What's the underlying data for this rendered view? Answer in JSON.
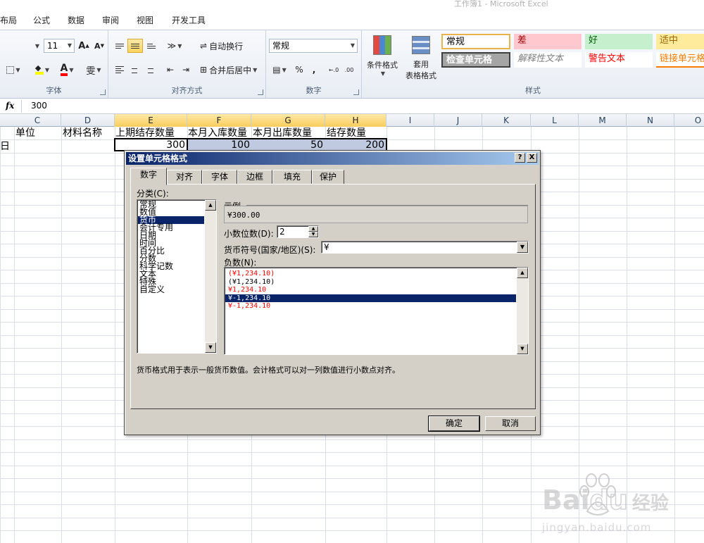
{
  "window": {
    "title": "工作簿1 - Microsoft Excel"
  },
  "ribbon_tabs": [
    "布局",
    "公式",
    "数据",
    "审阅",
    "视图",
    "开发工具"
  ],
  "font_group": {
    "label": "字体",
    "size": "11",
    "grow_icon": "A",
    "shrink_icon": "A",
    "font_color_icon": "A",
    "phonetic_icon": "雯"
  },
  "align_group": {
    "label": "对齐方式",
    "wrap_text": "自动换行",
    "merge_center": "合并后居中"
  },
  "number_group": {
    "label": "数字",
    "format": "常规",
    "percent": "%",
    "comma": ",",
    "inc_decimal": "←.0",
    "dec_decimal": ".00"
  },
  "styles_group": {
    "label": "样式",
    "conditional": "条件格式",
    "table_line1": "套用",
    "table_line2": "表格格式",
    "cells": [
      {
        "text": "常规",
        "bg": "#ffffff",
        "fg": "#000000"
      },
      {
        "text": "差",
        "bg": "#ffc7ce",
        "fg": "#9c0006"
      },
      {
        "text": "好",
        "bg": "#c6efce",
        "fg": "#006100"
      },
      {
        "text": "适中",
        "bg": "#ffeb9c",
        "fg": "#9c6500"
      },
      {
        "text": "检查单元格",
        "bg": "#a5a5a5",
        "fg": "#ffffff"
      },
      {
        "text": "解释性文本",
        "bg": "#ffffff",
        "fg": "#7f7f7f"
      },
      {
        "text": "警告文本",
        "bg": "#ffffff",
        "fg": "#ff0000"
      },
      {
        "text": "链接单元格",
        "bg": "#ffffff",
        "fg": "#fa7d00"
      }
    ]
  },
  "formula_bar": {
    "fx": "fx",
    "value": "300"
  },
  "columns": [
    "C",
    "D",
    "E",
    "F",
    "G",
    "H",
    "I",
    "J",
    "K",
    "L",
    "M",
    "N",
    "O"
  ],
  "sheet": {
    "row1": [
      "单位",
      "材料名称",
      "上期结存数量",
      "本月入库数量",
      "本月出库数量",
      "结存数量"
    ],
    "row2_left": "日",
    "row2_values": [
      "300",
      "100",
      "50",
      "200"
    ]
  },
  "dialog": {
    "title": "设置单元格格式",
    "help_btn": "?",
    "close_btn": "X",
    "tabs": [
      "数字",
      "对齐",
      "字体",
      "边框",
      "填充",
      "保护"
    ],
    "category_label": "分类(C):",
    "categories": [
      "常规",
      "数值",
      "货币",
      "会计专用",
      "日期",
      "时间",
      "百分比",
      "分数",
      "科学记数",
      "文本",
      "特殊",
      "自定义"
    ],
    "selected_category": "货币",
    "sample_label": "示例",
    "sample_value": "¥300.00",
    "decimal_label": "小数位数(D):",
    "decimal_value": "2",
    "symbol_label": "货币符号(国家/地区)(S):",
    "symbol_value": "¥",
    "negative_label": "负数(N):",
    "negatives": [
      {
        "text": "(¥1,234.10)",
        "color": "#ff0000"
      },
      {
        "text": "(¥1,234.10)",
        "color": "#000000"
      },
      {
        "text": "¥1,234.10",
        "color": "#ff0000"
      },
      {
        "text": "¥-1,234.10",
        "color": "#000000"
      },
      {
        "text": "¥-1,234.10",
        "color": "#ff0000"
      }
    ],
    "selected_negative": 3,
    "description": "货币格式用于表示一般货币数值。会计格式可以对一列数值进行小数点对齐。",
    "ok": "确定",
    "cancel": "取消"
  },
  "watermark": {
    "brand": "Bai",
    "brand2": "du",
    "brand_cn": "经验",
    "url": "jingyan.baidu.com"
  }
}
